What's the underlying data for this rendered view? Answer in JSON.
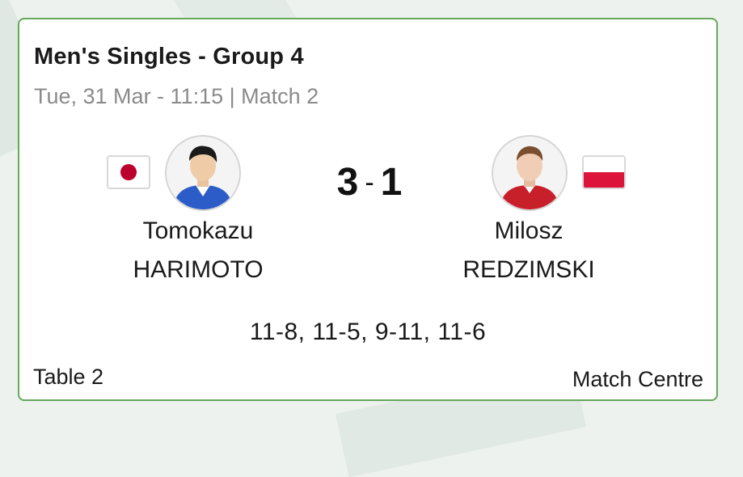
{
  "event": {
    "title": "Men's Singles - Group 4",
    "subtitle": "Tue, 31 Mar - 11:15 | Match 2"
  },
  "player_left": {
    "first_name": "Tomokazu",
    "last_name": "HARIMOTO",
    "flag_icon": "japan-flag-icon",
    "avatar_icon": "player-photo-icon"
  },
  "player_right": {
    "first_name": "Milosz",
    "last_name": "REDZIMSKI",
    "flag_icon": "poland-flag-icon",
    "avatar_icon": "player-photo-icon"
  },
  "score": {
    "left": "3",
    "separator": "-",
    "right": "1"
  },
  "games": "11-8, 11-5, 9-11, 11-6",
  "footer": {
    "table": "Table 2",
    "link": "Match Centre"
  },
  "colors": {
    "card_border": "#64a85a",
    "jp_red": "#bc002d",
    "pl_red": "#dc143c"
  }
}
